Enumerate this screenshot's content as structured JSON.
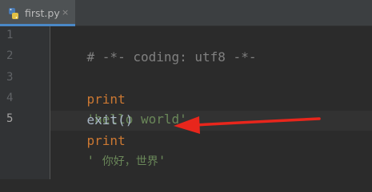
{
  "tab": {
    "filename": "first.py",
    "close": "×",
    "icon": "python-file-icon"
  },
  "gutter": {
    "line_numbers": [
      "1",
      "2",
      "3",
      "4",
      "5"
    ]
  },
  "code": {
    "line1": {
      "comment": "# -*- coding: utf8 -*-"
    },
    "line3": {
      "keyword": "print",
      "string": "'hello world'"
    },
    "line4": {
      "call": "exit()"
    },
    "line5": {
      "keyword": "print",
      "string_open": "' ",
      "string_text": "你好，世界",
      "string_close": "'"
    }
  },
  "colors": {
    "background": "#2b2b2b",
    "keyword": "#cc7832",
    "string": "#6a8759",
    "comment": "#808080",
    "annotation_arrow": "#e8261c"
  }
}
